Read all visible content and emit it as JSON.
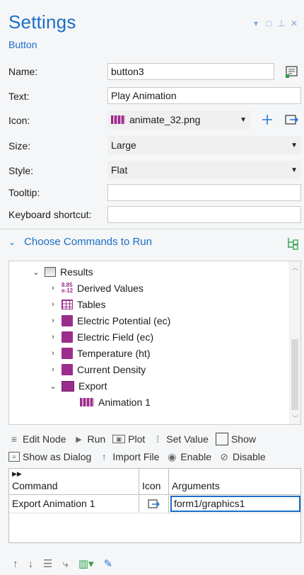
{
  "header": {
    "title": "Settings",
    "subtitle": "Button"
  },
  "form": {
    "name_label": "Name:",
    "name_value": "button3",
    "text_label": "Text:",
    "text_value": "Play Animation",
    "icon_label": "Icon:",
    "icon_value": "animate_32.png",
    "size_label": "Size:",
    "size_value": "Large",
    "style_label": "Style:",
    "style_value": "Flat",
    "tooltip_label": "Tooltip:",
    "tooltip_value": "",
    "shortcut_label": "Keyboard shortcut:",
    "shortcut_value": ""
  },
  "section": {
    "title": "Choose Commands to Run"
  },
  "tree": {
    "results": "Results",
    "derived_badge_top": "8.85",
    "derived_badge_bottom": "e-12",
    "items": [
      "Derived Values",
      "Tables",
      "Electric Potential (ec)",
      "Electric Field (ec)",
      "Temperature (ht)",
      "Current Density",
      "Export"
    ],
    "animation": "Animation 1"
  },
  "toolbar": {
    "edit_node": "Edit Node",
    "run": "Run",
    "plot": "Plot",
    "set_value": "Set Value",
    "show": "Show",
    "show_as_dialog": "Show as Dialog",
    "import_file": "Import File",
    "enable": "Enable",
    "disable": "Disable"
  },
  "grid": {
    "headers": {
      "command": "Command",
      "icon": "Icon",
      "arguments": "Arguments"
    },
    "rows": [
      {
        "command": "Export Animation 1",
        "arguments": "form1/graphics1"
      }
    ]
  },
  "colors": {
    "accent": "#1a6ec8",
    "results_purple": "#9b2d8c"
  }
}
